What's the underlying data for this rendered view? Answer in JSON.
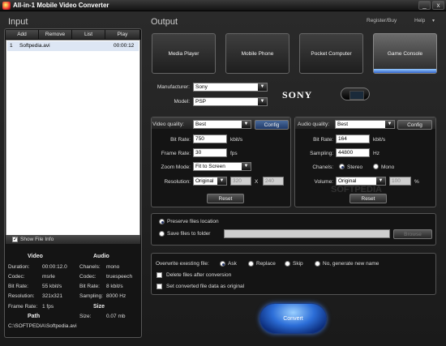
{
  "window": {
    "title": "All-in-1 Mobile Video Converter",
    "minimize": "_",
    "close": "x"
  },
  "top_links": {
    "register": "Register/Buy",
    "help": "Help"
  },
  "input": {
    "title": "Input",
    "toolbar": [
      "Add",
      "Remove",
      "List",
      "Play"
    ],
    "files": [
      {
        "index": "1",
        "name": "Softpedia.avi",
        "duration": "00:00:12"
      }
    ],
    "show_info_label": "Show File Info",
    "info": {
      "video_header": "Video",
      "audio_header": "Audio",
      "size_header": "Size",
      "path_header": "Path",
      "duration_label": "Duration:",
      "duration": "00:00:12.0",
      "vcodec_label": "Codec:",
      "vcodec": "msrle",
      "vbitrate_label": "Bit Rate:",
      "vbitrate": "55 kbit/s",
      "resolution_label": "Resolution:",
      "resolution": "321x321",
      "framerate_label": "Frame Rate:",
      "framerate": "1 fps",
      "channels_label": "Chanels:",
      "channels": "mono",
      "acodec_label": "Codec:",
      "acodec": "truespeech",
      "abitrate_label": "Bit Rate:",
      "abitrate": "8 kbit/s",
      "sampling_label": "Sampling:",
      "sampling": "8000 Hz",
      "size_label": "Size:",
      "size": "0.07 mb",
      "path": "C:\\SOFTPEDIA\\Softpedia.avi"
    }
  },
  "output": {
    "title": "Output",
    "devices": [
      "Media Player",
      "Mobile Phone",
      "Pocket Computer",
      "Game Console"
    ],
    "manufacturer_label": "Manufacturer:",
    "manufacturer": "Sony",
    "model_label": "Model:",
    "model": "PSP",
    "brand_logo": "SONY"
  },
  "video": {
    "quality_label": "Video quality:",
    "quality": "Best",
    "config": "Config",
    "bitrate_label": "Bit Rate:",
    "bitrate": "750",
    "bitrate_unit": "kbit/s",
    "framerate_label": "Frame Rate:",
    "framerate": "30",
    "framerate_unit": "fps",
    "zoom_label": "Zoom Mode:",
    "zoom": "Fit to Screen",
    "resolution_label": "Resolution:",
    "resolution": "Original",
    "res_w": "320",
    "res_x": "X",
    "res_h": "240",
    "reset": "Reset"
  },
  "audio": {
    "quality_label": "Audio quality:",
    "quality": "Best",
    "config": "Config",
    "bitrate_label": "Bit Rate:",
    "bitrate": "164",
    "bitrate_unit": "kbit/s",
    "sampling_label": "Sampling:",
    "sampling": "44800",
    "sampling_unit": "Hz",
    "channels_label": "Chanels:",
    "stereo": "Stereo",
    "mono": "Mono",
    "volume_label": "Volume:",
    "volume": "Original",
    "volume_val": "100",
    "volume_unit": "%",
    "reset": "Reset"
  },
  "location": {
    "preserve": "Preserve files location",
    "save_to": "Save files to folder",
    "browse": "Browse"
  },
  "options": {
    "overwrite_label": "Overwrite exesting file:",
    "ask": "Ask",
    "replace": "Replace",
    "skip": "Skip",
    "no": "No, generate new name",
    "delete_after": "Delete files after conversion",
    "set_original": "Set converted file data as original"
  },
  "convert": "Convert",
  "watermark": "SOFTPEDIA"
}
